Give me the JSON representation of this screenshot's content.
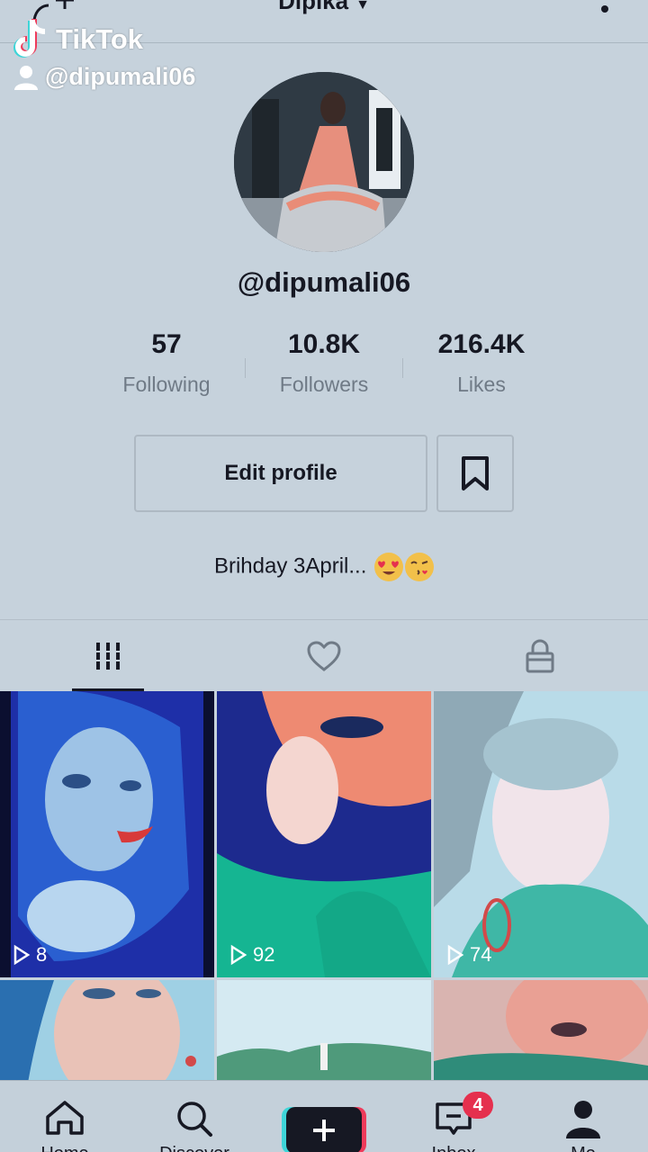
{
  "header": {
    "title": "Dipika",
    "add_user_icon": "add-user-icon",
    "more_icon": "more-icon"
  },
  "watermark": {
    "brand": "TikTok",
    "handle": "@dipumali06"
  },
  "profile": {
    "username": "@dipumali06",
    "stats": [
      {
        "value": "57",
        "label": "Following"
      },
      {
        "value": "10.8K",
        "label": "Followers"
      },
      {
        "value": "216.4K",
        "label": "Likes"
      }
    ],
    "edit_label": "Edit profile",
    "bio": "Brihday 3April... ",
    "bio_emojis": [
      "heart-eyes",
      "kiss"
    ]
  },
  "tabs": [
    {
      "icon": "videos-grid-icon",
      "active": true
    },
    {
      "icon": "heart-icon",
      "active": false
    },
    {
      "icon": "lock-icon",
      "active": false
    }
  ],
  "videos": [
    {
      "views": "8"
    },
    {
      "views": "92"
    },
    {
      "views": "74"
    },
    {
      "views": ""
    },
    {
      "views": ""
    },
    {
      "views": ""
    }
  ],
  "nav": {
    "home_label": "Home",
    "discover_label": "Discover",
    "inbox_label": "Inbox",
    "me_label": "Me",
    "inbox_badge": "4"
  },
  "colors": {
    "accent_red": "#ee3a5a",
    "accent_cyan": "#3ed5d8",
    "text": "#161823"
  }
}
